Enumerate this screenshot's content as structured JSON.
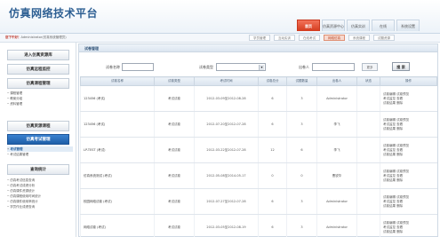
{
  "header": {
    "logo": "仿真网络技术平台",
    "nav": [
      "首页",
      "仿真资源中心",
      "仿真实训",
      "在线",
      "系统设置"
    ]
  },
  "subbar": {
    "welcome_prefix": "您下午好！",
    "welcome_text": "Administrator(仿真系统管理员)",
    "tabs": [
      "学员管理",
      "互动实训",
      "在线考试",
      "网络仿真",
      "系统课程",
      "试题资源"
    ]
  },
  "sidebar": {
    "buttons": [
      "进入仿真资源库",
      "仿真远程监控",
      "仿真课程管理",
      "仿真资源课程",
      "仿真考试管理",
      "查询统计"
    ],
    "course_items": [
      "课程管理",
      "教案分组",
      "资料管理"
    ],
    "exam_items": [
      "考试管理",
      "考试结果管理"
    ],
    "stats_items": [
      "仿真考试信息查询",
      "仿真考试成绩分析",
      "仿真课件资源统计",
      "仿真课程使用时间统计",
      "仿真课件使用率统计",
      "学员作业成绩查询"
    ]
  },
  "main": {
    "title": "试卷管理",
    "filter": {
      "paper_name_label": "试卷名称",
      "paper_type_label": "试卷类型",
      "author_label": "出卷人",
      "paper_type_value": "",
      "more_label": "更多",
      "search_label": "搜 索"
    },
    "columns": [
      "试卷名称",
      "试卷类型",
      "考试时间",
      "试卷总分",
      "试题数量",
      "出卷人",
      "状态",
      "操作"
    ],
    "rows": [
      {
        "name": "123456 (考试)",
        "type": "考试试卷",
        "time": "2012-03-09至2012-08-28",
        "score": "6",
        "count": "3",
        "author": "Administrator",
        "status": "",
        "ops": [
          "试卷编辑  试卷预览",
          "考试监控  查看",
          "试卷结果  删除"
        ]
      },
      {
        "name": "123456 (考试)",
        "type": "考试试卷",
        "time": "2012-07-20至2012-07-28",
        "score": "6",
        "count": "3",
        "author": "李飞",
        "status": "",
        "ops": [
          "试卷编辑  试卷预览",
          "考试监控  查看",
          "试卷结果  删除"
        ]
      },
      {
        "name": "LP-TEST (考试)",
        "type": "考试试卷",
        "time": "2012-03-22至2012-07-28",
        "score": "12",
        "count": "6",
        "author": "李飞",
        "status": "",
        "ops": [
          "试卷编辑  试卷预览",
          "考试监控  查看",
          "试卷结果  删除"
        ]
      },
      {
        "name": "仿真系统测试 (考试)",
        "type": "考试试卷",
        "time": "2012-05-08至2014-05-17",
        "score": "0",
        "count": "0",
        "author": "曹锐华",
        "status": "",
        "ops": [
          "试卷编辑  试卷预览",
          "考试监控  查看",
          "试卷结果  删除"
        ]
      },
      {
        "name": "校园网络试卷 (考试)",
        "type": "考试试卷",
        "time": "2012-07-27至2012-07-28",
        "score": "6",
        "count": "3",
        "author": "Administrator",
        "status": "",
        "ops": [
          "试卷编辑  试卷预览",
          "考试监控  查看",
          "试卷结果  删除"
        ]
      },
      {
        "name": "网络试卷 (考试)",
        "type": "考试试卷",
        "time": "2012-03-05至2012-08-19",
        "score": "6",
        "count": "3",
        "author": "Administrator",
        "status": "",
        "ops": [
          "试卷编辑  试卷预览",
          "考试监控  查看",
          "试卷结果  删除"
        ]
      }
    ]
  },
  "colors": {
    "brand": "#2d5f93",
    "active_tab": "#d33b1e",
    "sidebar_active": "#1e5ea8",
    "link": "#2a62a8"
  }
}
